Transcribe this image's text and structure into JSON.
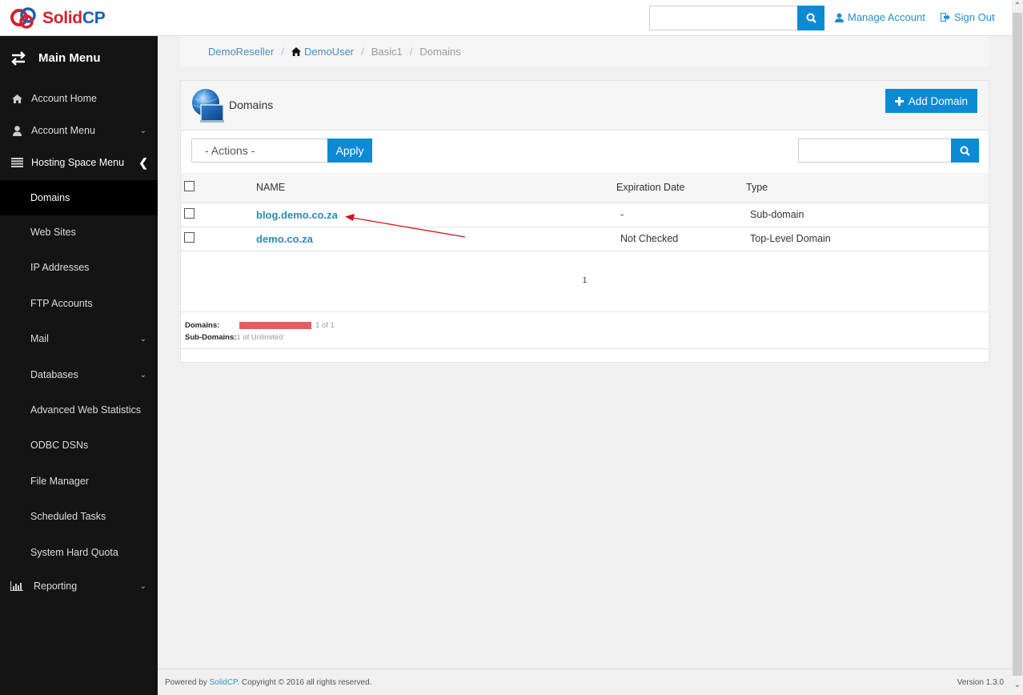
{
  "app": {
    "logo_text_1": "Solid",
    "logo_text_2": "CP"
  },
  "header": {
    "search_placeholder": "",
    "manage_account": "Manage Account",
    "sign_out": "Sign Out"
  },
  "sidebar": {
    "title": "Main Menu",
    "items": [
      {
        "label": "Account Home",
        "icon": "home-icon"
      },
      {
        "label": "Account Menu",
        "icon": "user-icon",
        "caret": "down"
      },
      {
        "label": "Hosting Space Menu",
        "icon": "list-icon",
        "caret": "left"
      },
      {
        "label": "Domains",
        "active": true
      },
      {
        "label": "Web Sites"
      },
      {
        "label": "IP Addresses"
      },
      {
        "label": "FTP Accounts"
      },
      {
        "label": "Mail",
        "caret": "down"
      },
      {
        "label": "Databases",
        "caret": "down"
      },
      {
        "label": "Advanced Web Statistics"
      },
      {
        "label": "ODBC DSNs"
      },
      {
        "label": "File Manager"
      },
      {
        "label": "Scheduled Tasks"
      },
      {
        "label": "System Hard Quota"
      },
      {
        "label": "Reporting",
        "icon": "bar-chart-icon",
        "caret": "down"
      }
    ]
  },
  "breadcrumb": {
    "items": [
      "DemoReseller",
      "DemoUser",
      "Basic1",
      "Domains"
    ],
    "separator": "/"
  },
  "panel": {
    "title": "Domains",
    "add_button": "Add Domain",
    "actions_select": "- Actions -",
    "apply_button": "Apply",
    "search_placeholder": ""
  },
  "table": {
    "columns": [
      "NAME",
      "Expiration Date",
      "Type"
    ],
    "rows": [
      {
        "name": "blog.demo.co.za",
        "expiration": "-",
        "type": "Sub-domain"
      },
      {
        "name": "demo.co.za",
        "expiration": "Not Checked",
        "type": "Top-Level Domain"
      }
    ]
  },
  "pager": {
    "current_page": "1"
  },
  "quota": {
    "domains_label": "Domains:",
    "domains_value": "1 of 1",
    "domains_used_fraction": 1.0,
    "subdomains_label": "Sub-Domains:",
    "subdomains_value": "1 of Unlimited"
  },
  "footer": {
    "powered_by": "Powered by ",
    "brand_link": "SolidCP",
    "copyright": ". Copyright © 2016 all rights reserved.",
    "version": "Version 1.3.0"
  },
  "colors": {
    "accent": "#0c8ad4",
    "link": "#2a8ab8",
    "sidebar_bg": "#141414",
    "quota_bar": "#e85c5c",
    "annotation_arrow": "#d0121b"
  }
}
